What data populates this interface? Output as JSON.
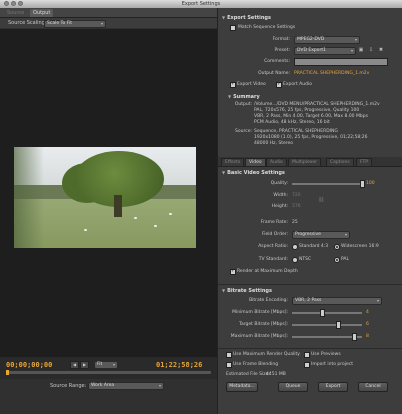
{
  "window": {
    "title": "Export Settings"
  },
  "left": {
    "tabs": [
      "Source",
      "Output"
    ],
    "source_scaling_label": "Source Scaling:",
    "source_scaling_value": "Scale To Fit",
    "timecode_in": "00;00;00;00",
    "timecode_out": "01;22;58;26",
    "zoom_value": "Fit",
    "source_range_label": "Source Range:",
    "source_range_value": "Work Area"
  },
  "export_settings": {
    "header": "Export Settings",
    "match_sequence": "Match Sequence Settings",
    "format_label": "Format:",
    "format_value": "MPEG2-DVD",
    "preset_label": "Preset:",
    "preset_value": "DVD Export1",
    "comments_label": "Comments:",
    "output_name_label": "Output Name:",
    "output_name_value": "PRACTICAL SHEPHERDING_1.m2v",
    "export_video": "Export Video",
    "export_audio": "Export Audio"
  },
  "summary": {
    "header": "Summary",
    "output_label": "Output:",
    "output_lines": [
      "/Volume.../DVD MENU/PRACTICAL SHEPHERDING_1.m2v",
      "PAL, 720x576, 25 fps, Progressive, Quality 100",
      "VBR, 2 Pass, Min 4.00, Target 6.00, Max 8.00 Mbps",
      "PCM Audio, 48 kHz, Stereo, 16 bit"
    ],
    "source_label": "Source:",
    "source_lines": [
      "Sequence, PRACTICAL SHEPHERDING",
      "1920x1080 (1.0), 25 fps, Progressive, 01;22;58;26",
      "48000 Hz, Stereo"
    ]
  },
  "subtabs": [
    "Effects",
    "Video",
    "Audio",
    "Multiplexer",
    "Captions",
    "FTP"
  ],
  "basic_video": {
    "header": "Basic Video Settings",
    "quality_label": "Quality:",
    "quality_value": "100",
    "width_label": "Width:",
    "width_value": "720",
    "height_label": "Height:",
    "height_value": "576",
    "frame_rate_label": "Frame Rate:",
    "frame_rate_value": "25",
    "field_order_label": "Field Order:",
    "field_order_value": "Progressive",
    "aspect_label": "Aspect Ratio:",
    "aspect_standard": "Standard 4:3",
    "aspect_wide": "Widescreen 16:9",
    "tv_label": "TV Standard:",
    "tv_ntsc": "NTSC",
    "tv_pal": "PAL",
    "render_max_depth": "Render at Maximum Depth"
  },
  "bitrate": {
    "header": "Bitrate Settings",
    "encoding_label": "Bitrate Encoding:",
    "encoding_value": "VBR, 2 Pass",
    "min_label": "Minimum Bitrate [Mbps]:",
    "min_value": "4",
    "target_label": "Target Bitrate [Mbps]:",
    "target_value": "6",
    "max_label": "Maximum Bitrate [Mbps]:",
    "max_value": "8"
  },
  "footer": {
    "max_render_quality": "Use Maximum Render Quality",
    "use_previews": "Use Previews",
    "frame_blending": "Use Frame Blending",
    "import_project": "Import into project",
    "file_size_label": "Estimated File Size:",
    "file_size_value": "4451 MB",
    "metadata": "Metadata...",
    "queue": "Queue",
    "export": "Export",
    "cancel": "Cancel"
  },
  "colors": {
    "accent": "#e8a53a",
    "panel": "#3d3d3d"
  }
}
